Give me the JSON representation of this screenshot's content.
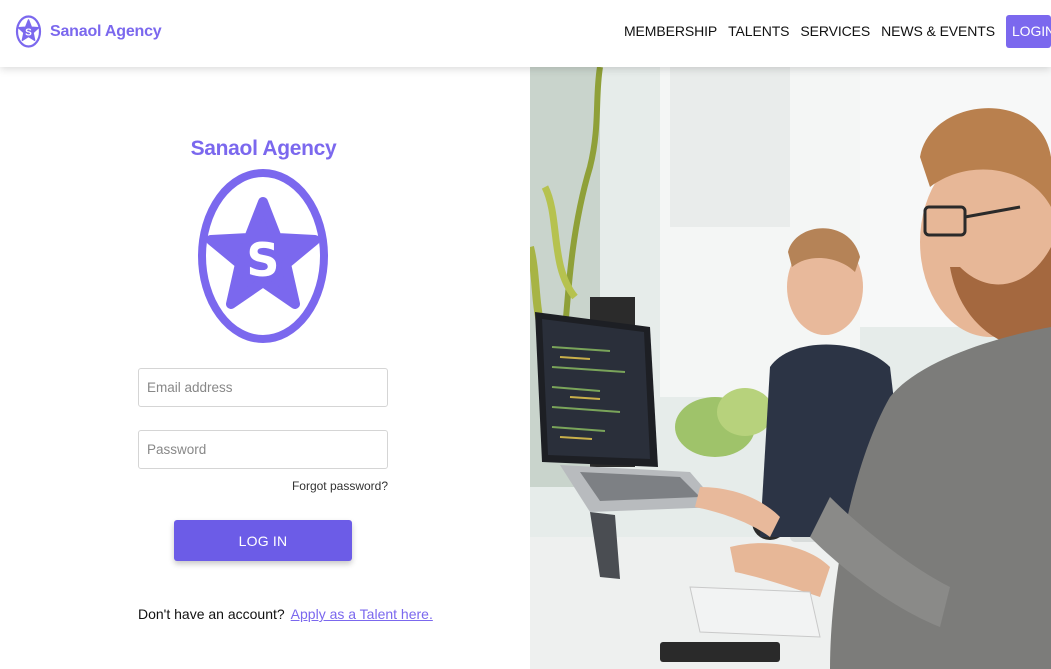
{
  "brand": {
    "name": "Sanaol Agency",
    "logo_letter": "S",
    "color": "#7b68ee"
  },
  "nav": {
    "items": [
      "MEMBERSHIP",
      "TALENTS",
      "SERVICES",
      "NEWS & EVENTS"
    ],
    "login_label": "LOGIN"
  },
  "form": {
    "title": "Sanaol Agency",
    "logo_letter": "S",
    "email_placeholder": "Email address",
    "email_value": "",
    "password_placeholder": "Password",
    "password_value": "",
    "forgot_label": "Forgot password?",
    "submit_label": "LOG IN",
    "signup_text": "Don't have an account?",
    "signup_link": "Apply as a Talent here."
  },
  "hero_image": {
    "subject": "two-men-working-at-computers-photo"
  },
  "colors": {
    "accent": "#7b68ee",
    "button": "#6c5ce7"
  }
}
